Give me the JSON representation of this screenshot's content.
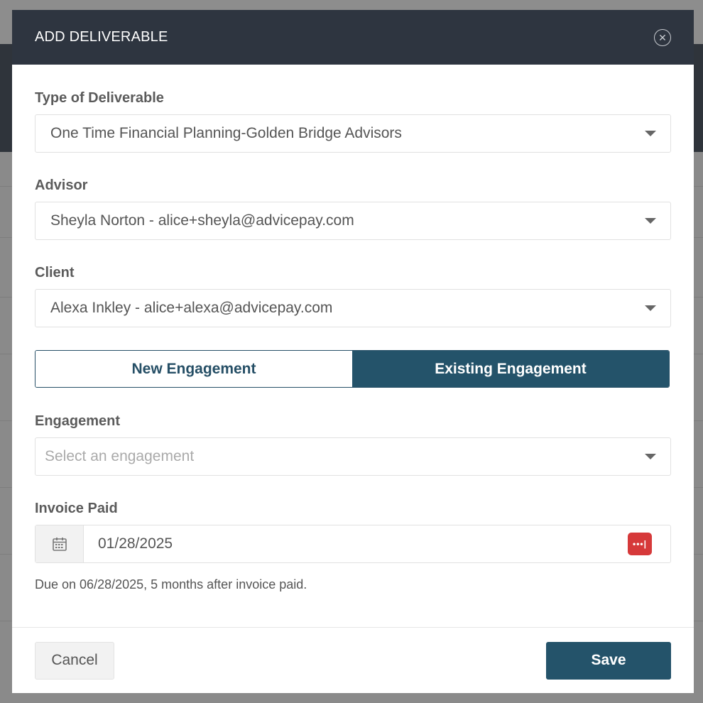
{
  "modal": {
    "title": "ADD DELIVERABLE",
    "close_icon": "close-circle-icon"
  },
  "fields": {
    "type_of_deliverable": {
      "label": "Type of Deliverable",
      "value": "One Time Financial Planning-Golden Bridge Advisors"
    },
    "advisor": {
      "label": "Advisor",
      "value": "Sheyla Norton - alice+sheyla@advicepay.com"
    },
    "client": {
      "label": "Client",
      "value": "Alexa Inkley - alice+alexa@advicepay.com"
    },
    "engagement": {
      "label": "Engagement",
      "placeholder": "Select an engagement"
    },
    "invoice_paid": {
      "label": "Invoice Paid",
      "value": "01/28/2025",
      "hint": "Due on 06/28/2025, 5 months after invoice paid."
    }
  },
  "toggle": {
    "new_label": "New Engagement",
    "existing_label": "Existing Engagement",
    "selected": "existing"
  },
  "footer": {
    "cancel_label": "Cancel",
    "save_label": "Save"
  },
  "colors": {
    "header_bg": "#2e3540",
    "primary": "#24536a",
    "password_badge": "#d6393a"
  }
}
